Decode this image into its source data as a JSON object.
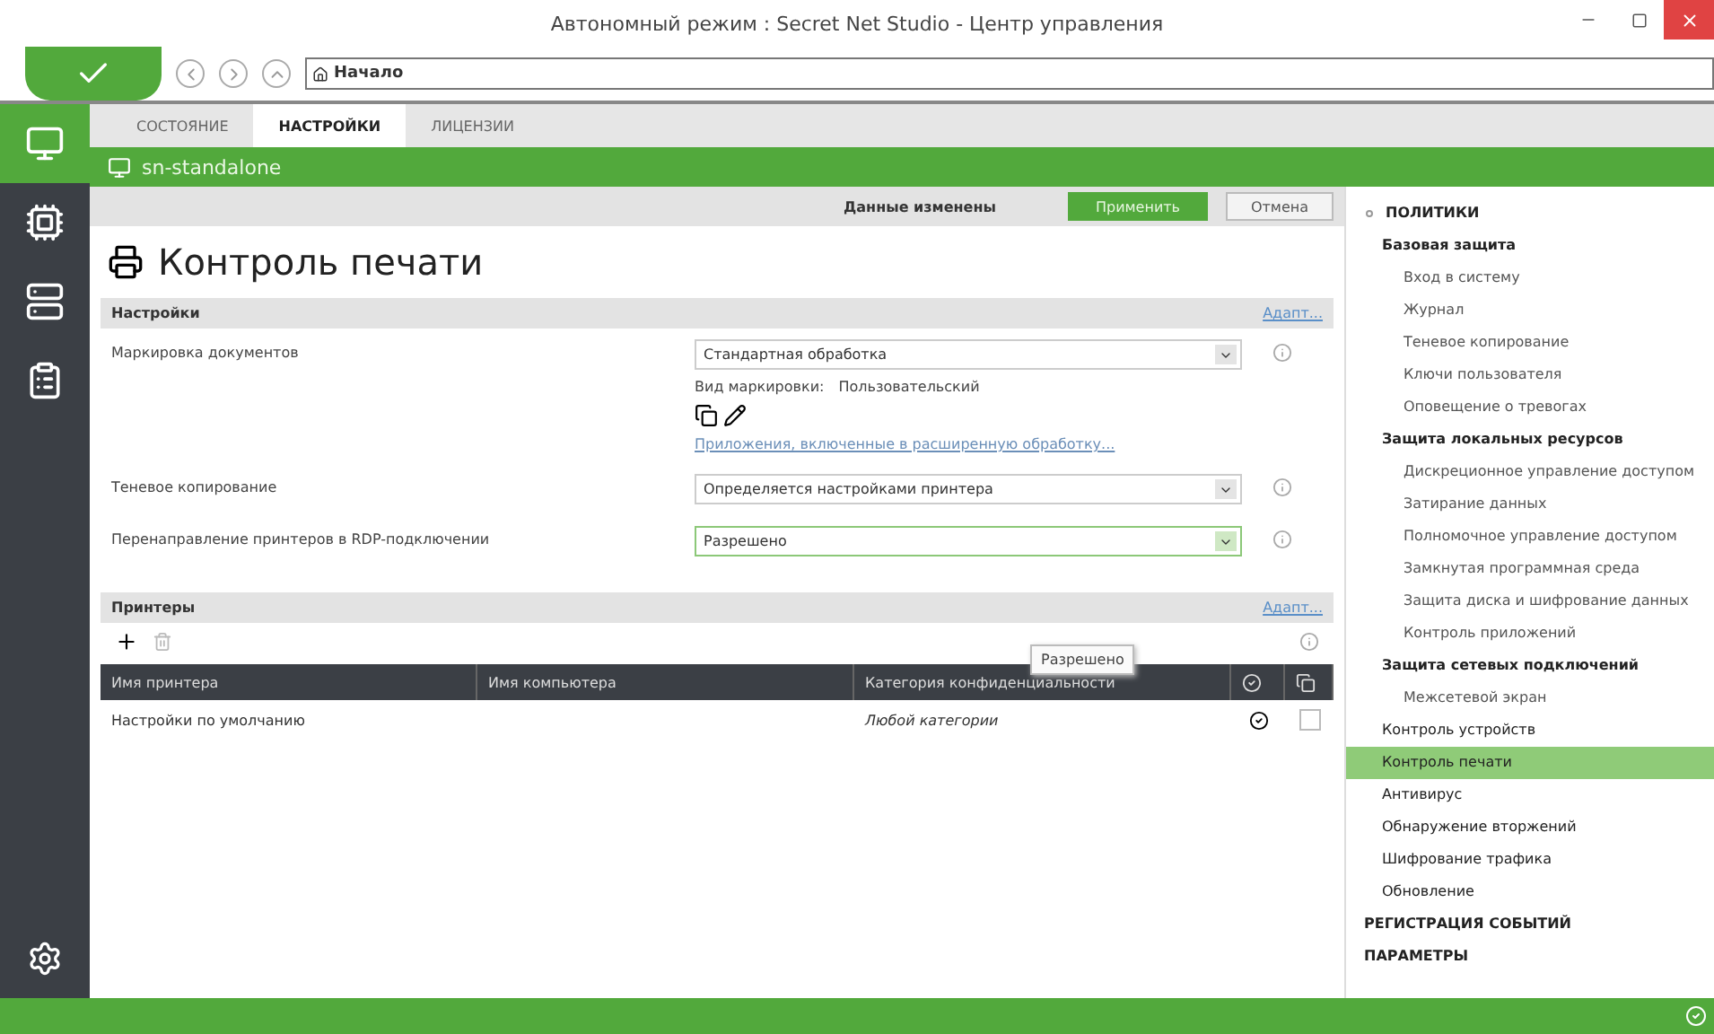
{
  "window": {
    "title": "Автономный режим : Secret Net Studio - Центр управления"
  },
  "toolbar": {
    "address": "Начало"
  },
  "nav": [
    {
      "kind": "monitor",
      "selected": true
    },
    {
      "kind": "agent",
      "selected": false
    },
    {
      "kind": "server",
      "selected": false
    },
    {
      "kind": "clipboard",
      "selected": false
    },
    {
      "kind": "settings",
      "selected": false
    }
  ],
  "tabs": [
    {
      "label": "СОСТОЯНИЕ",
      "selected": false
    },
    {
      "label": "НАСТРОЙКИ",
      "selected": true
    },
    {
      "label": "ЛИЦЕНЗИИ",
      "selected": false
    }
  ],
  "host": "sn-standalone",
  "action_bar": {
    "status": "Данные изменены",
    "apply": "Применить",
    "cancel": "Отмена"
  },
  "page_title": "Контроль печати",
  "settings": {
    "title": "Настройки",
    "link": "Адапт...",
    "rows": [
      {
        "label": "Маркировка документов",
        "value": "Стандартная обработка",
        "highlighted": false,
        "marking_label": "Вид маркировки:",
        "marking_value": "Пользовательский",
        "apps_link": "Приложения, включенные в расширенную обработку..."
      },
      {
        "label": "Теневое копирование",
        "value": "Определяется настройками принтера",
        "highlighted": false
      },
      {
        "label": "Перенаправление принтеров в RDP-подключении",
        "value": "Разрешено",
        "highlighted": true
      }
    ],
    "tooltip": "Разрешено"
  },
  "printers": {
    "title": "Принтеры",
    "link": "Адапт...",
    "columns": [
      "Имя принтера",
      "Имя компьютера",
      "Категория конфиденциальности"
    ],
    "rows": [
      {
        "printer": "Настройки по умолчанию",
        "computer": "",
        "category": "Любой категории",
        "checked": false
      }
    ]
  },
  "tree": [
    {
      "label": "ПОЛИТИКИ",
      "kind": "root",
      "expanded": true,
      "selected": false,
      "children": [
        {
          "label": "Базовая защита",
          "kind": "group",
          "selected": false,
          "children": [
            {
              "label": "Вход в систему",
              "kind": "leaf",
              "selected": false
            },
            {
              "label": "Журнал",
              "kind": "leaf",
              "selected": false
            },
            {
              "label": "Теневое копирование",
              "kind": "leaf",
              "selected": false
            },
            {
              "label": "Ключи пользователя",
              "kind": "leaf",
              "selected": false
            },
            {
              "label": "Оповещение о тревогах",
              "kind": "leaf",
              "selected": false
            }
          ]
        },
        {
          "label": "Защита локальных ресурсов",
          "kind": "group",
          "selected": false,
          "children": [
            {
              "label": "Дискреционное управление доступом",
              "kind": "leaf",
              "selected": false
            },
            {
              "label": "Затирание данных",
              "kind": "leaf",
              "selected": false
            },
            {
              "label": "Полномочное управление доступом",
              "kind": "leaf",
              "selected": false
            },
            {
              "label": "Замкнутая программная среда",
              "kind": "leaf",
              "selected": false
            },
            {
              "label": "Защита диска и шифрование данных",
              "kind": "leaf",
              "selected": false
            },
            {
              "label": "Контроль приложений",
              "kind": "leaf",
              "selected": false
            }
          ]
        },
        {
          "label": "Защита сетевых подключений",
          "kind": "group",
          "selected": false,
          "children": [
            {
              "label": "Межсетевой экран",
              "kind": "leaf",
              "selected": false
            }
          ]
        },
        {
          "label": "Контроль устройств",
          "kind": "item",
          "selected": false
        },
        {
          "label": "Контроль печати",
          "kind": "item",
          "selected": true
        },
        {
          "label": "Антивирус",
          "kind": "item",
          "selected": false
        },
        {
          "label": "Обнаружение вторжений",
          "kind": "item",
          "selected": false
        },
        {
          "label": "Шифрование трафика",
          "kind": "item",
          "selected": false
        },
        {
          "label": "Обновление",
          "kind": "item",
          "selected": false
        }
      ]
    },
    {
      "label": "РЕГИСТРАЦИЯ СОБЫТИЙ",
      "kind": "root",
      "selected": false
    },
    {
      "label": "ПАРАМЕТРЫ",
      "kind": "root",
      "selected": false
    }
  ]
}
